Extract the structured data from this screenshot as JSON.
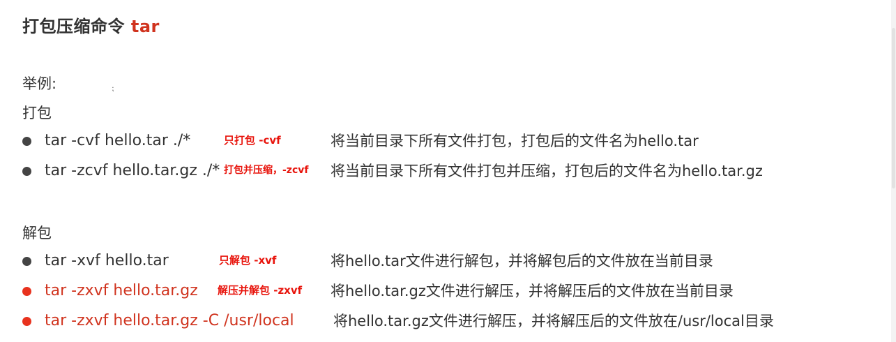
{
  "title": {
    "text": "打包压缩命令",
    "command": "tar"
  },
  "example_label": "举例:",
  "stray_mark": "⁏",
  "pack": {
    "label": "打包",
    "items": [
      {
        "command": "tar -cvf hello.tar ./*",
        "note": "只打包 -cvf",
        "description": "将当前目录下所有文件打包，打包后的文件名为hello.tar",
        "highlight": false
      },
      {
        "command": "tar -zcvf hello.tar.gz ./*",
        "note": "打包并压缩，-zcvf",
        "description": "将当前目录下所有文件打包并压缩，打包后的文件名为hello.tar.gz",
        "highlight": false
      }
    ]
  },
  "unpack": {
    "label": "解包",
    "items": [
      {
        "command": "tar -xvf hello.tar",
        "note": "只解包 -xvf",
        "description": "将hello.tar文件进行解包，并将解包后的文件放在当前目录",
        "highlight": false
      },
      {
        "command": "tar -zxvf hello.tar.gz",
        "note": "解压并解包 -zxvf",
        "description": "将hello.tar.gz文件进行解压，并将解压后的文件放在当前目录",
        "highlight": true
      },
      {
        "command": "tar -zxvf hello.tar.gz -C /usr/local",
        "note": "",
        "description": "将hello.tar.gz文件进行解压，并将解压后的文件放在/usr/local目录",
        "highlight": true
      }
    ]
  },
  "colors": {
    "accent_red": "#d0331e",
    "note_red": "#e8140c",
    "text": "#333333"
  }
}
